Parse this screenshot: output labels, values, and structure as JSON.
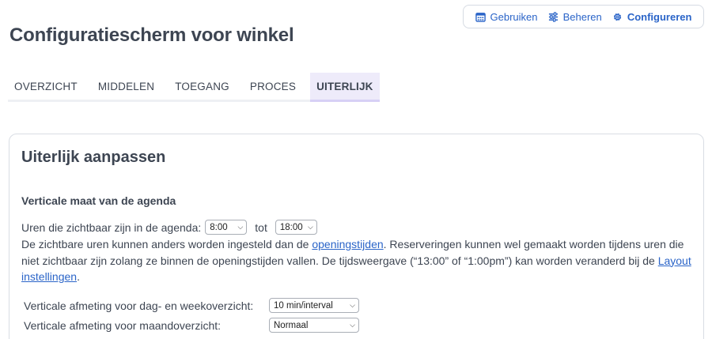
{
  "modes": [
    {
      "label": "Gebruiken",
      "icon": "calendar-icon",
      "active": false
    },
    {
      "label": "Beheren",
      "icon": "sliders-icon",
      "active": false
    },
    {
      "label": "Configureren",
      "icon": "gear-icon",
      "active": true
    }
  ],
  "page_title": "Configuratiescherm voor winkel",
  "tabs": [
    "OVERZICHT",
    "MIDDELEN",
    "TOEGANG",
    "PROCES",
    "UITERLIJK"
  ],
  "active_tab": "UITERLIJK",
  "card": {
    "title": "Uiterlijk aanpassen",
    "section_title": "Verticale maat van de agenda",
    "hours_label": "Uren die zichtbaar zijn in de agenda:",
    "hours_from": "8:00",
    "hours_between": "tot",
    "hours_to": "18:00",
    "desc_part1": "De zichtbare uren kunnen anders worden ingesteld dan de ",
    "desc_link1": "openingstijden",
    "desc_part2": ". Reserveringen kunnen wel gemaakt worden tijdens uren die niet zichtbaar zijn zolang ze binnen de openingstijden vallen. De tijdsweergave (“13:00” of “1:00pm”) kan worden veranderd bij de ",
    "desc_link2": "Layout instellingen",
    "desc_part3": ".",
    "day_week_label": "Verticale afmeting voor dag- en weekoverzicht:",
    "day_week_value": "10 min/interval",
    "month_label": "Verticale afmeting voor maandoverzicht:",
    "month_value": "Normaal"
  },
  "colors": {
    "accent": "#2a64c8",
    "tab_active_bg": "#eeebfa"
  }
}
